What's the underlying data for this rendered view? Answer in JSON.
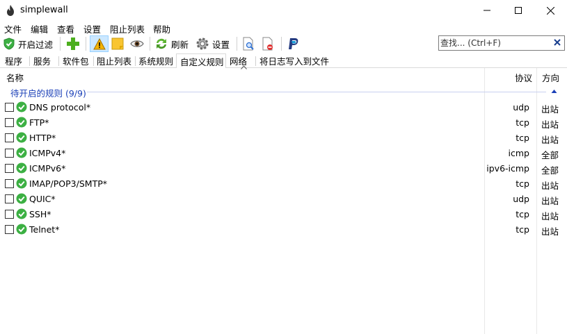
{
  "window": {
    "title": "simplewall"
  },
  "menu": [
    "文件",
    "编辑",
    "查看",
    "设置",
    "阻止列表",
    "帮助"
  ],
  "toolbar": {
    "enable_filter": "开启过滤",
    "refresh": "刷新",
    "settings": "设置"
  },
  "search": {
    "placeholder": "查找... (Ctrl+F)",
    "value": ""
  },
  "tabs": [
    "程序",
    "服务",
    "软件包",
    "阻止列表",
    "系统规则",
    "自定义规则",
    "网络",
    "将日志写入到文件"
  ],
  "active_tab_index": 5,
  "columns": {
    "name": "名称",
    "protocol": "协议",
    "direction": "方向"
  },
  "group": {
    "title": "待开启的规则 (9/9)"
  },
  "rules": [
    {
      "name": "DNS protocol*",
      "protocol": "udp",
      "direction": "出站"
    },
    {
      "name": "FTP*",
      "protocol": "tcp",
      "direction": "出站"
    },
    {
      "name": "HTTP*",
      "protocol": "tcp",
      "direction": "出站"
    },
    {
      "name": "ICMPv4*",
      "protocol": "icmp",
      "direction": "全部"
    },
    {
      "name": "ICMPv6*",
      "protocol": "ipv6-icmp",
      "direction": "全部"
    },
    {
      "name": "IMAP/POP3/SMTP*",
      "protocol": "tcp",
      "direction": "出站"
    },
    {
      "name": "QUIC*",
      "protocol": "udp",
      "direction": "出站"
    },
    {
      "name": "SSH*",
      "protocol": "tcp",
      "direction": "出站"
    },
    {
      "name": "Telnet*",
      "protocol": "tcp",
      "direction": "出站"
    }
  ],
  "colors": {
    "accent": "#1a3fb7",
    "ok_green": "#3cb043",
    "pressed": "#cce8ff"
  }
}
